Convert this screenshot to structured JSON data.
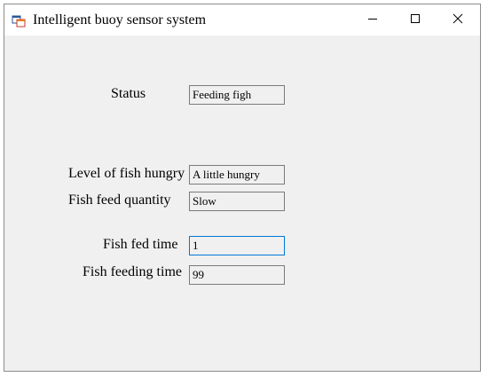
{
  "window": {
    "title": "Intelligent buoy sensor system"
  },
  "icons": {
    "app": "app-window-icon",
    "minimize": "minimize-icon",
    "maximize": "maximize-icon",
    "close": "close-icon"
  },
  "form": {
    "status": {
      "label": "Status",
      "value": "Feeding figh"
    },
    "hunger": {
      "label": "Level of fish hungry",
      "value": "A little hungry"
    },
    "feed_quantity": {
      "label": "Fish feed quantity",
      "value": "Slow"
    },
    "fed_time": {
      "label": "Fish fed time",
      "value": "1"
    },
    "feeding_time": {
      "label": "Fish feeding time",
      "value": "99"
    }
  },
  "colors": {
    "window_bg": "#f0f0f0",
    "focus_border": "#0078d7"
  }
}
